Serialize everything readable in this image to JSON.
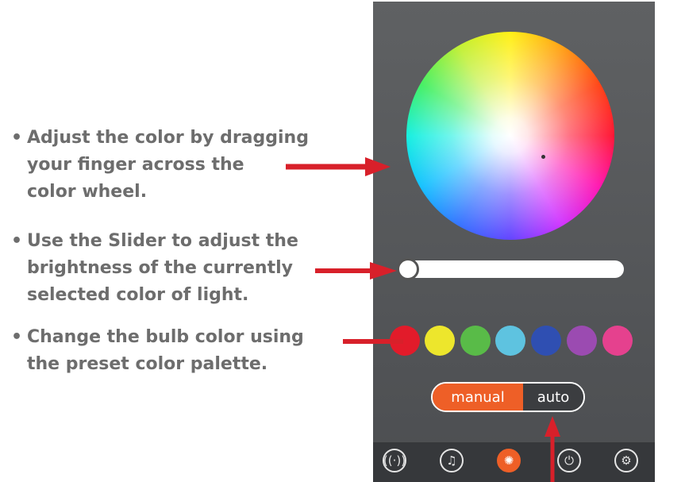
{
  "instructions": [
    {
      "bullet": "•",
      "lines": [
        "Adjust the color by dragging",
        "your finger across the",
        "color wheel."
      ]
    },
    {
      "bullet": "•",
      "lines": [
        "Use the Slider to adjust  the",
        "brightness of the currently",
        "selected color of light."
      ]
    },
    {
      "bullet": "•",
      "lines": [
        "Change the bulb color using",
        "the preset color palette."
      ]
    }
  ],
  "app": {
    "brightness": {
      "value": 0.0
    },
    "palette": [
      "#e21b2a",
      "#ede62c",
      "#59bb48",
      "#5ec3e0",
      "#2f4fb2",
      "#9b4bb1",
      "#e5418e"
    ],
    "mode_toggle": {
      "manual_label": "manual",
      "auto_label": "auto",
      "selected": "manual"
    },
    "tabs": [
      {
        "icon": "speaker-icon",
        "glyph": "((·))"
      },
      {
        "icon": "music-note-icon",
        "glyph": "♫"
      },
      {
        "icon": "light-bulb-icon",
        "glyph": "✺",
        "active": true
      },
      {
        "icon": "power-icon",
        "glyph": "⏻"
      },
      {
        "icon": "gear-icon",
        "glyph": "⚙"
      }
    ]
  },
  "colors": {
    "text": "#6d6d6d",
    "arrow": "#d8202a",
    "panel": "#55575a",
    "accent": "#ee5f27",
    "tabbar": "#36383b"
  }
}
